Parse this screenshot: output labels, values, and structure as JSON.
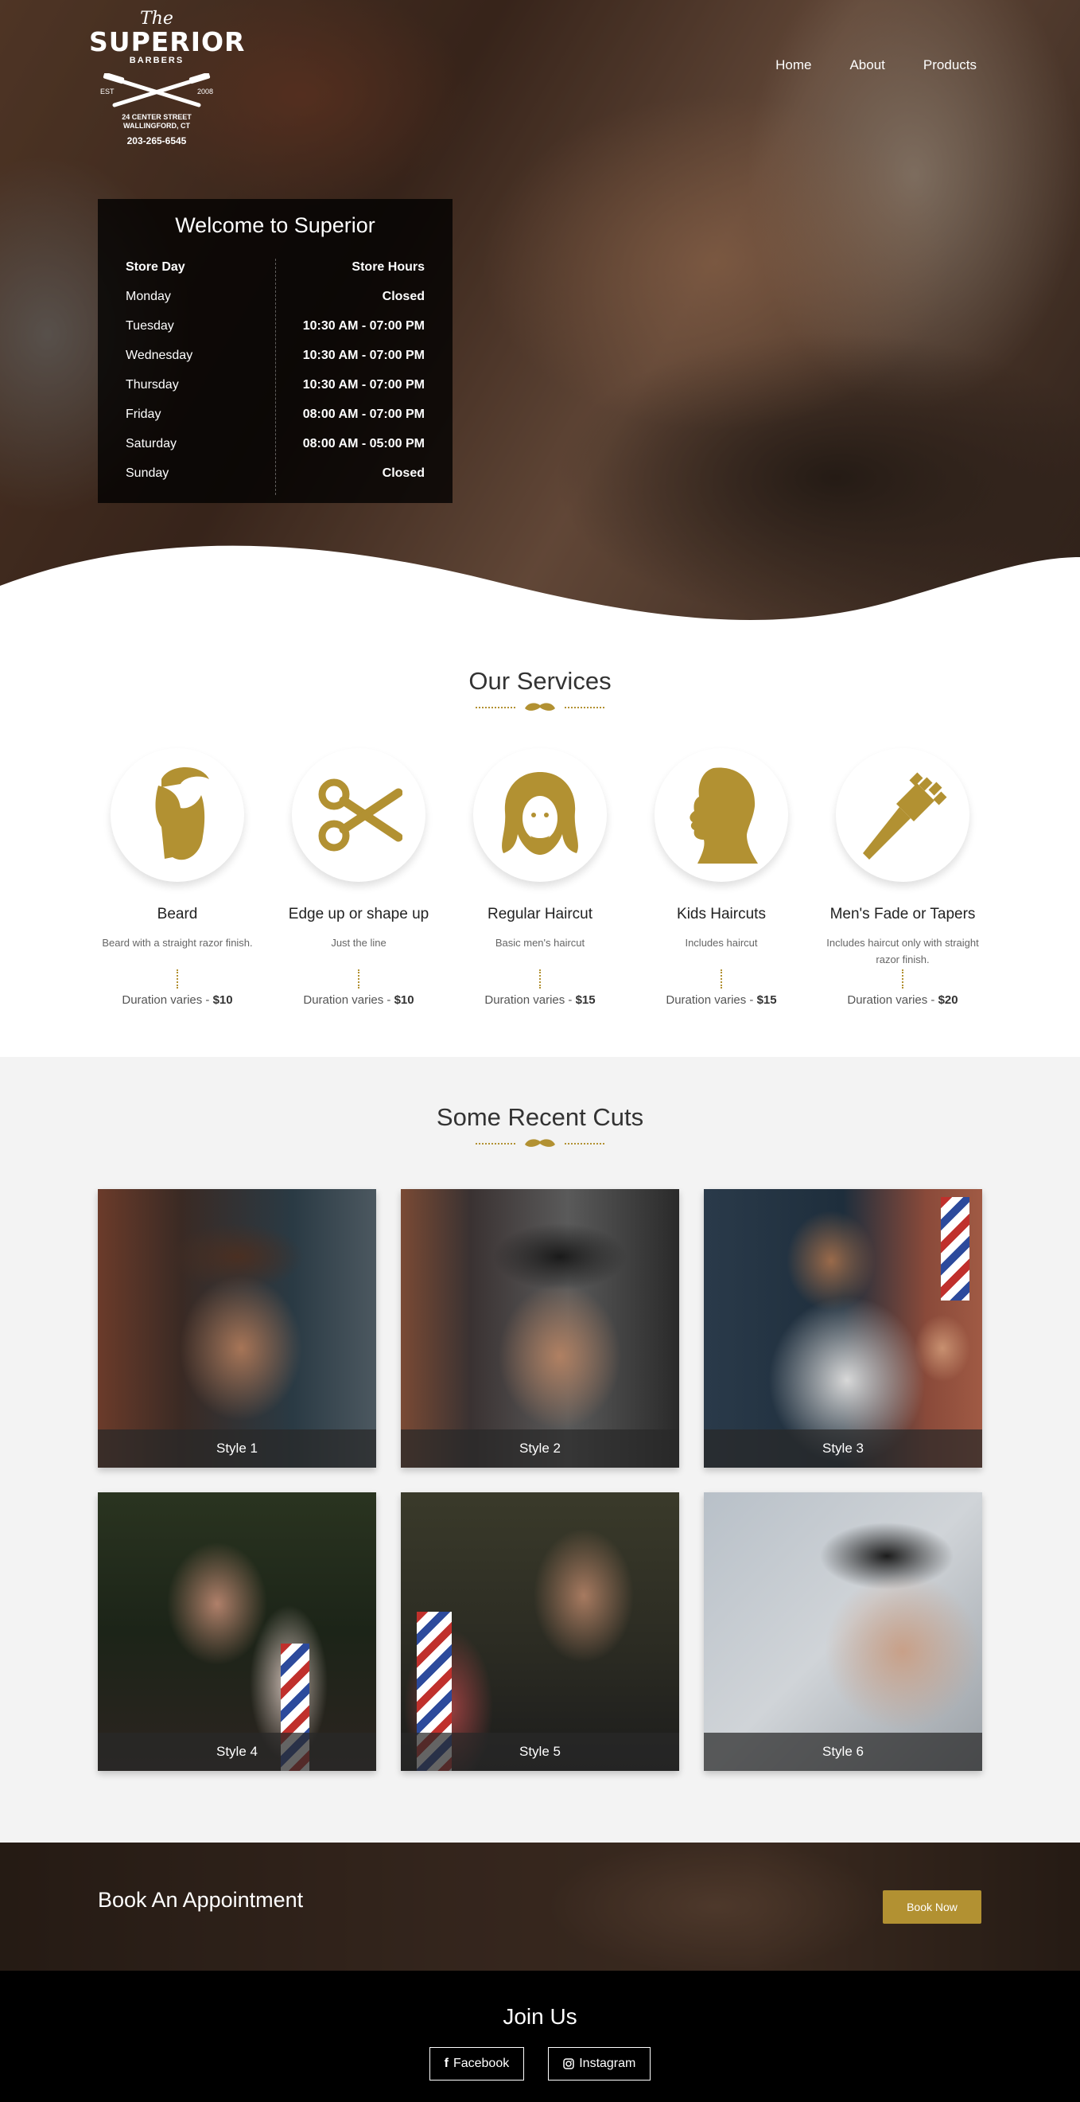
{
  "brand": {
    "the": "The",
    "name": "SUPERIOR",
    "sub": "BARBERS",
    "est_left": "EST",
    "est_right": "2008",
    "address_line1": "24 CENTER STREET",
    "address_line2": "WALLINGFORD, CT",
    "phone": "203-265-6545"
  },
  "nav": {
    "home": "Home",
    "about": "About",
    "products": "Products"
  },
  "hours": {
    "title": "Welcome to Superior",
    "col_day": "Store Day",
    "col_hours": "Store Hours",
    "rows": [
      {
        "day": "Monday",
        "time": "Closed"
      },
      {
        "day": "Tuesday",
        "time": "10:30 AM - 07:00 PM"
      },
      {
        "day": "Wednesday",
        "time": "10:30 AM - 07:00 PM"
      },
      {
        "day": "Thursday",
        "time": "10:30 AM - 07:00 PM"
      },
      {
        "day": "Friday",
        "time": "08:00 AM - 07:00 PM"
      },
      {
        "day": "Saturday",
        "time": "08:00 AM - 05:00 PM"
      },
      {
        "day": "Sunday",
        "time": "Closed"
      }
    ]
  },
  "services": {
    "title": "Our Services",
    "duration_label": "Duration varies - ",
    "items": [
      {
        "name": "Beard",
        "desc": "Beard with a straight razor finish.",
        "price": "$10",
        "icon": "beard-icon"
      },
      {
        "name": "Edge up or shape up",
        "desc": "Just the line",
        "price": "$10",
        "icon": "scissors-icon"
      },
      {
        "name": "Regular Haircut",
        "desc": "Basic men's haircut",
        "price": "$15",
        "icon": "long-hair-icon"
      },
      {
        "name": "Kids Haircuts",
        "desc": "Includes haircut",
        "price": "$15",
        "icon": "child-head-icon"
      },
      {
        "name": "Men's Fade or Tapers",
        "desc": "Includes haircut only with straight razor finish.",
        "price": "$20",
        "icon": "clipper-icon"
      }
    ]
  },
  "cuts": {
    "title": "Some Recent Cuts",
    "items": [
      "Style 1",
      "Style 2",
      "Style 3",
      "Style 4",
      "Style 5",
      "Style 6"
    ]
  },
  "book": {
    "title": "Book An Appointment",
    "button": "Book Now"
  },
  "footer": {
    "title": "Join Us",
    "facebook": "Facebook",
    "instagram": "Instagram"
  },
  "colors": {
    "accent": "#b29132",
    "dark": "#000000",
    "light_bg": "#f3f3f3"
  }
}
